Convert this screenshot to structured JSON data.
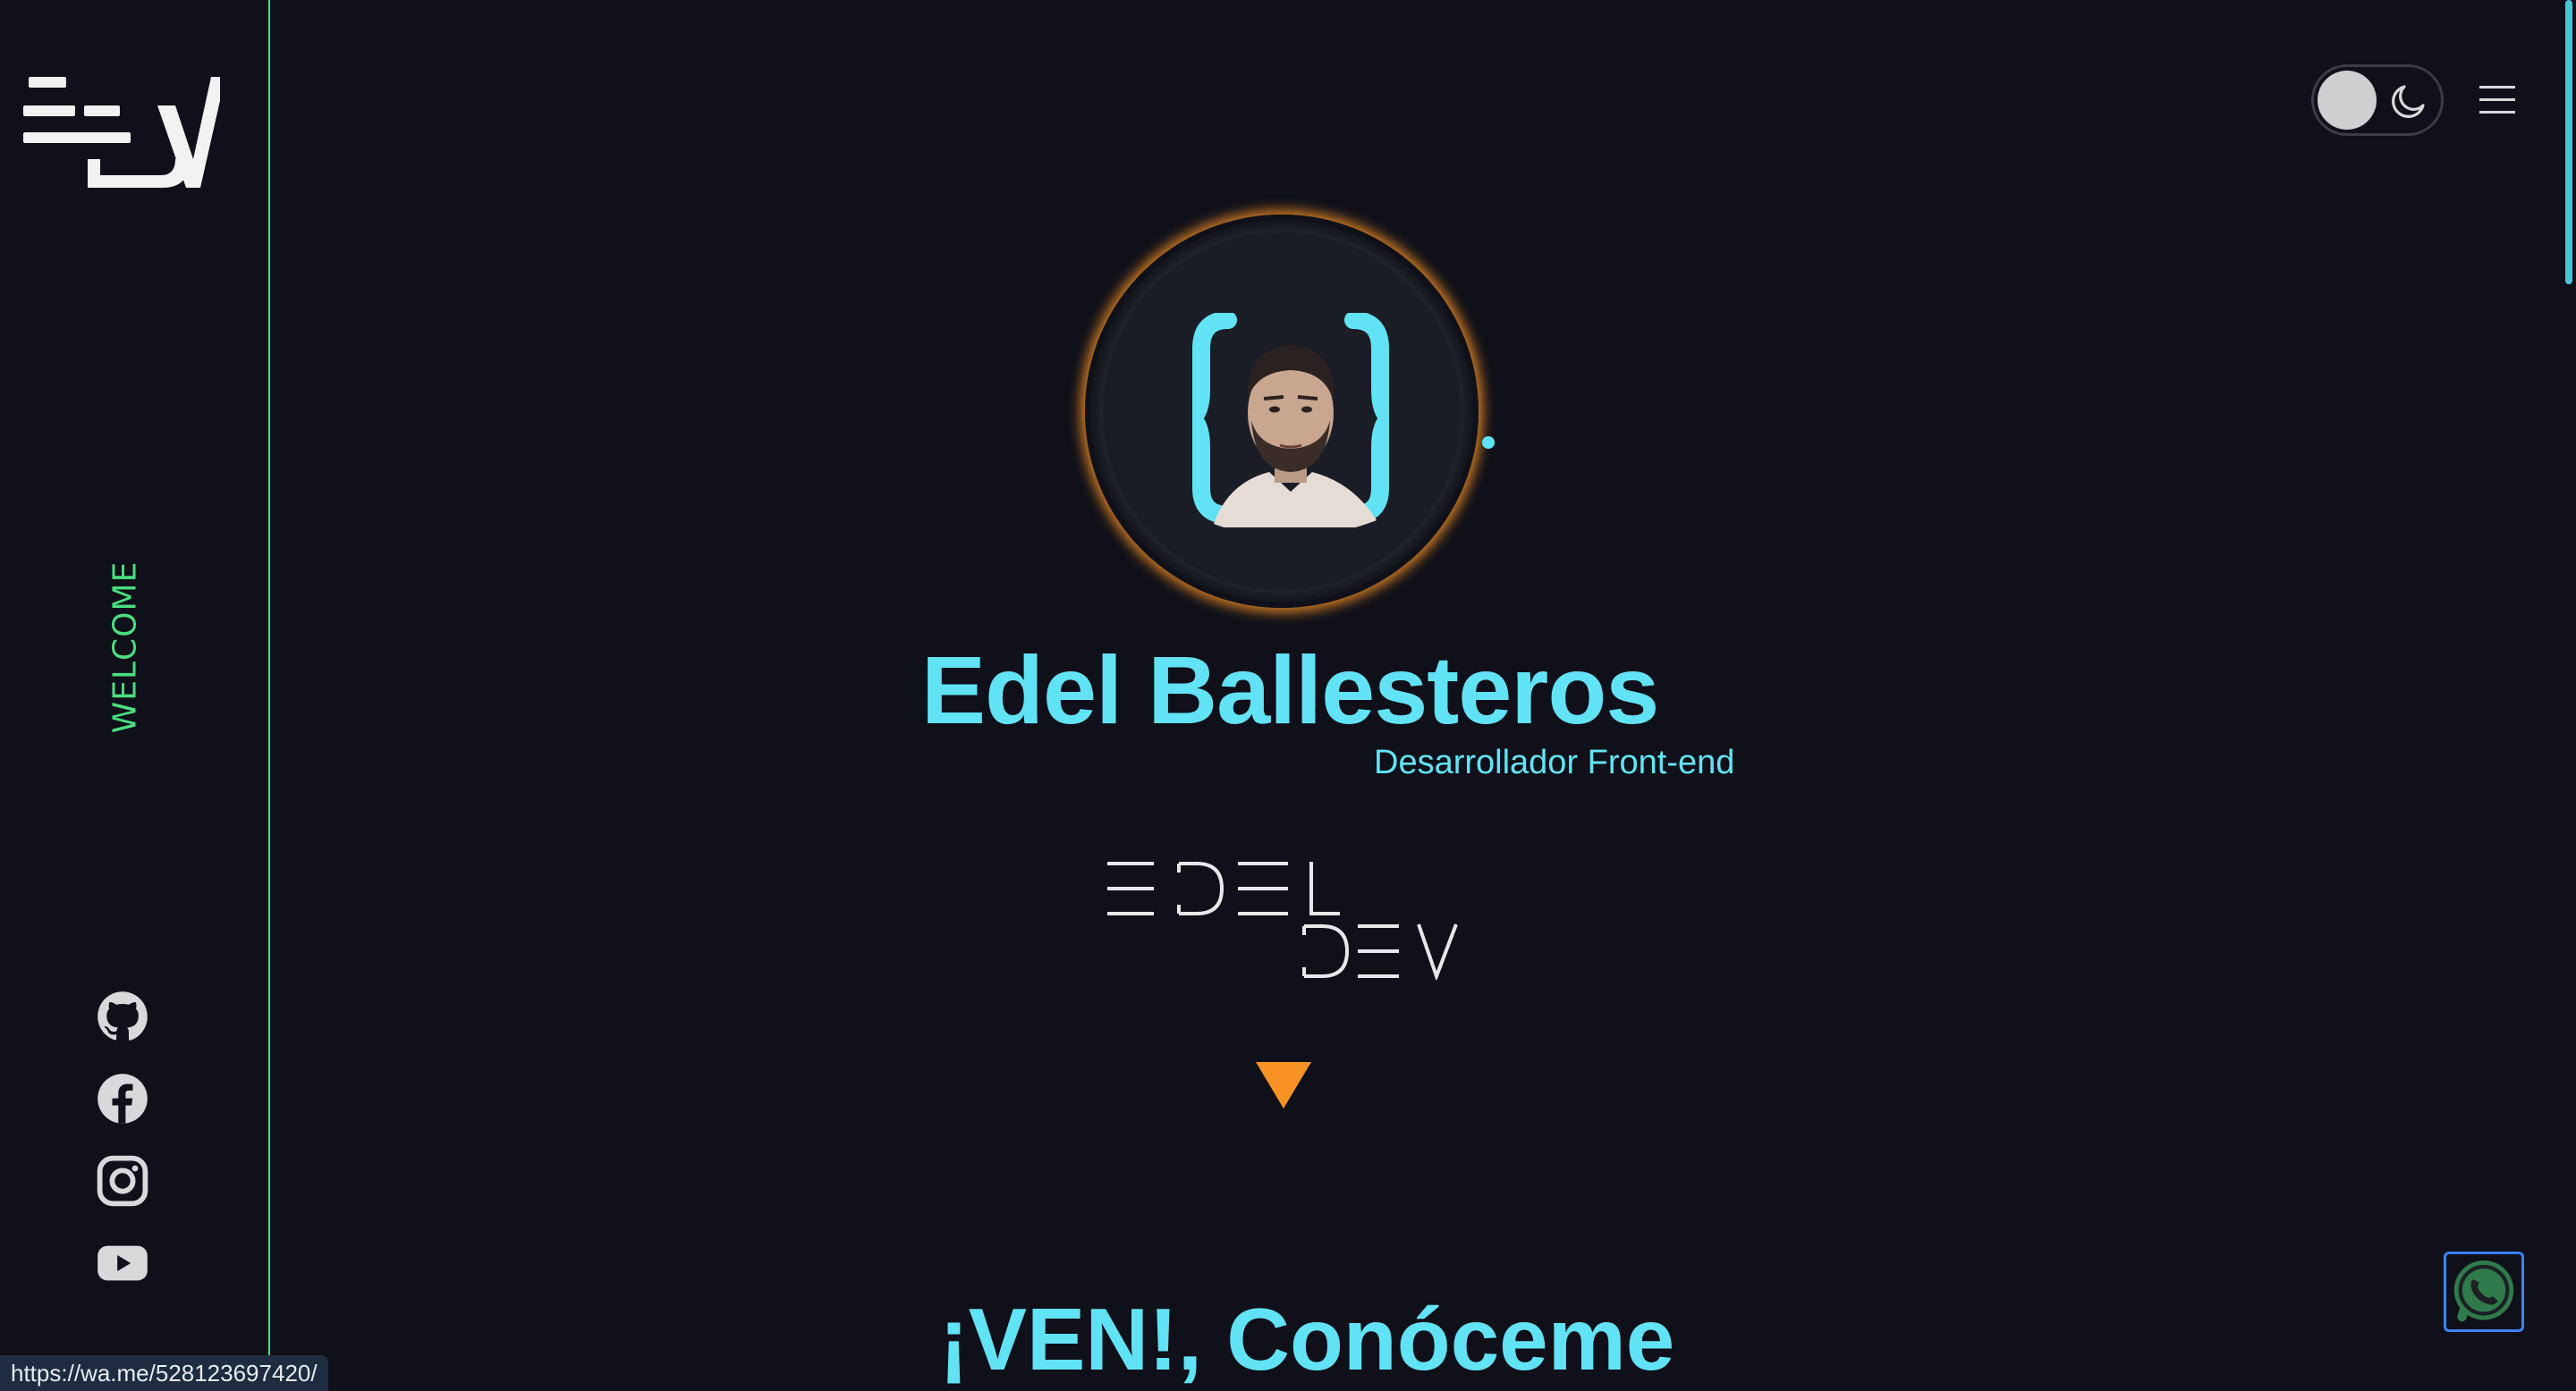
{
  "sidebar": {
    "logo_name": "edel-dev-logo",
    "welcome": "WELCOME",
    "socials": [
      {
        "name": "github",
        "icon": "github-icon"
      },
      {
        "name": "facebook",
        "icon": "facebook-icon"
      },
      {
        "name": "instagram",
        "icon": "instagram-icon"
      },
      {
        "name": "youtube",
        "icon": "youtube-icon"
      }
    ]
  },
  "header": {
    "theme_toggle": {
      "state": "dark",
      "icon": "moon-icon"
    },
    "menu_icon": "hamburger-menu-icon"
  },
  "hero": {
    "name": "Edel Ballesteros",
    "role": "Desarrollador Front-end",
    "brand_mark": "EDEL DEV",
    "scroll_icon": "down-triangle-icon"
  },
  "section": {
    "title": "¡VEN!, Conóceme"
  },
  "floating": {
    "whatsapp_icon": "whatsapp-icon"
  },
  "status_bar": {
    "url": "https://wa.me/528123697420/"
  },
  "colors": {
    "background": "#0f1019",
    "accent_cyan": "#62e3f5",
    "accent_green": "#4ade80",
    "accent_orange": "#f99224"
  }
}
